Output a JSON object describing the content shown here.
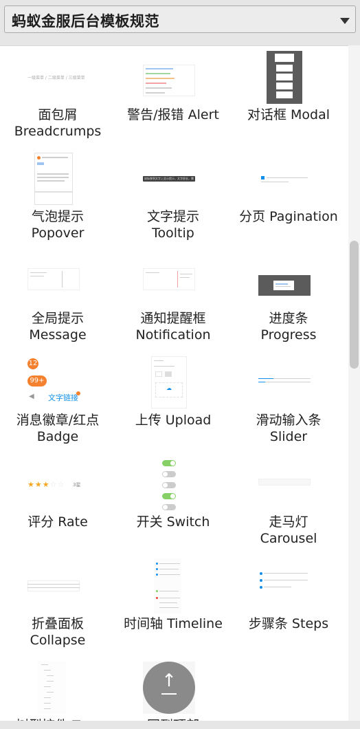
{
  "header": {
    "title": "蚂蚁金服后台模板规范"
  },
  "components": [
    {
      "line1": "面包屑",
      "line2": "Breadcrumps"
    },
    {
      "line1": "警告/报错 Alert",
      "line2": ""
    },
    {
      "line1": "对话框 Modal",
      "line2": ""
    },
    {
      "line1": "气泡提示",
      "line2": "Popover"
    },
    {
      "line1": "文字提示",
      "line2": "Tooltip"
    },
    {
      "line1": "分页 Pagination",
      "line2": ""
    },
    {
      "line1": "全局提示",
      "line2": "Message"
    },
    {
      "line1": "通知提醒框",
      "line2": "Notification"
    },
    {
      "line1": "进度条",
      "line2": "Progress"
    },
    {
      "line1": "消息徽章/红点",
      "line2": "Badge"
    },
    {
      "line1": "上传 Upload",
      "line2": ""
    },
    {
      "line1": "滑动输入条",
      "line2": "Slider"
    },
    {
      "line1": "评分 Rate",
      "line2": ""
    },
    {
      "line1": "开关 Switch",
      "line2": ""
    },
    {
      "line1": "走马灯",
      "line2": "Carousel"
    },
    {
      "line1": "折叠面板",
      "line2": "Collapse"
    },
    {
      "line1": "时间轴 Timeline",
      "line2": ""
    },
    {
      "line1": "步骤条 Steps",
      "line2": ""
    },
    {
      "line1": "树型控件 Tree",
      "line2": ""
    },
    {
      "line1": "回到顶部",
      "line2": ""
    }
  ],
  "thumb_text": {
    "breadcrumb": "一级菜单 / 二级菜单 / 三级菜单",
    "badge_count_1": "12",
    "badge_count_2": "99+",
    "badge_link": "文字链接",
    "rate_text": "3星",
    "tooltip_text": "鼠标移到文字上显示提示，文字很长，需要换行"
  },
  "colors": {
    "primary": "#108ee9",
    "badge": "#f5802d",
    "backtop": "#8a8a8a"
  }
}
